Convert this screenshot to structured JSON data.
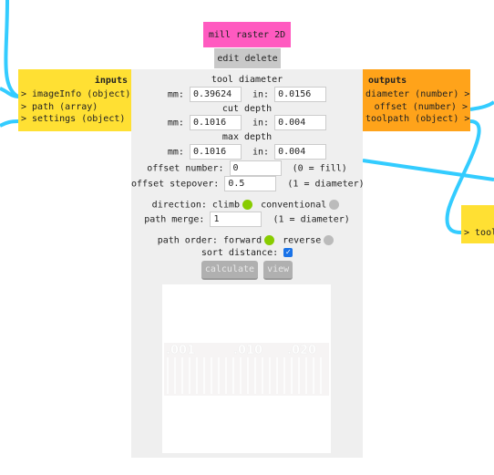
{
  "node": {
    "title": "mill raster 2D",
    "edit_label": "edit",
    "delete_label": "delete"
  },
  "inputs": {
    "header": "inputs",
    "ports": [
      "> imageInfo (object)",
      "> path (array)",
      "> settings (object)"
    ]
  },
  "outputs": {
    "header": "outputs",
    "ports": [
      "diameter (number) >",
      "offset (number) >",
      "toolpath (object) >"
    ]
  },
  "downstream": {
    "port": "> tool"
  },
  "form": {
    "tool_diameter": {
      "label": "tool diameter",
      "mm_label": "mm:",
      "mm": "0.39624",
      "in_label": "in:",
      "in": "0.0156"
    },
    "cut_depth": {
      "label": "cut depth",
      "mm_label": "mm:",
      "mm": "0.1016",
      "in_label": "in:",
      "in": "0.004"
    },
    "max_depth": {
      "label": "max depth",
      "mm_label": "mm:",
      "mm": "0.1016",
      "in_label": "in:",
      "in": "0.004"
    },
    "offset_number": {
      "label": "offset number:",
      "value": "0",
      "hint": "(0 = fill)"
    },
    "offset_stepover": {
      "label": "offset stepover:",
      "value": "0.5",
      "hint": "(1 = diameter)"
    },
    "direction": {
      "label": "direction:",
      "opt1": "climb",
      "opt2": "conventional",
      "selected": "climb"
    },
    "path_merge": {
      "label": "path merge:",
      "value": "1",
      "hint": "(1 = diameter)"
    },
    "path_order": {
      "label": "path order:",
      "opt1": "forward",
      "opt2": "reverse",
      "selected": "forward"
    },
    "sort_distance": {
      "label": "sort distance:",
      "checked": true
    },
    "calculate_label": "calculate",
    "view_label": "view"
  },
  "preview": {
    "labels": [
      ".001",
      ".010",
      ".020"
    ]
  },
  "colors": {
    "node_title": "#ff5ac0",
    "inputs": "#ffe033",
    "outputs": "#ffa31a",
    "wire": "#33ccff",
    "selected": "#88cc00",
    "unselected": "#bbbbbb"
  }
}
